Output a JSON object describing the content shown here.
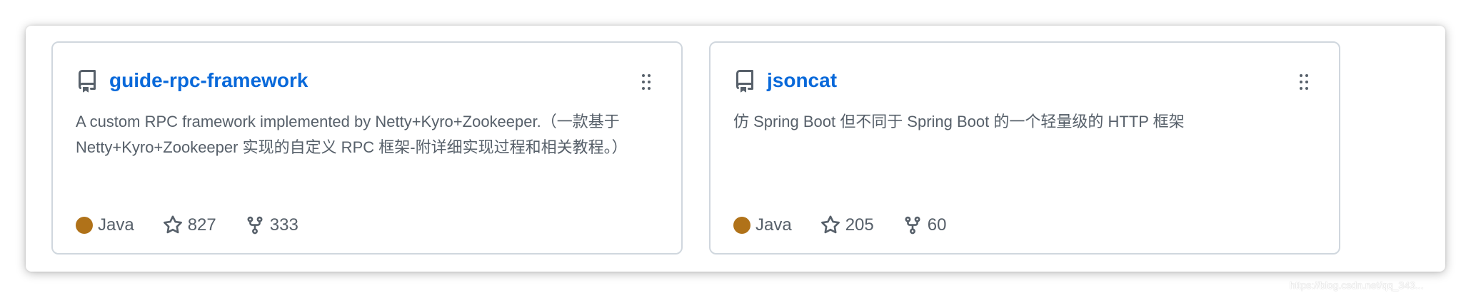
{
  "cards": [
    {
      "name": "guide-rpc-framework",
      "description": "A custom RPC framework implemented by Netty+Kyro+Zookeeper.（一款基于 Netty+Kyro+Zookeeper 实现的自定义 RPC 框架-附详细实现过程和相关教程。）",
      "language": "Java",
      "language_color": "#b07219",
      "stars": "827",
      "forks": "333"
    },
    {
      "name": "jsoncat",
      "description": "仿 Spring Boot 但不同于 Spring Boot 的一个轻量级的 HTTP 框架",
      "language": "Java",
      "language_color": "#b07219",
      "stars": "205",
      "forks": "60"
    }
  ],
  "icons": {
    "repo": "repo-icon",
    "drag": "grabber-icon",
    "star": "star-icon",
    "fork": "fork-icon"
  },
  "colors": {
    "link": "#0969da",
    "muted": "#57606a",
    "border": "#d0d7de"
  },
  "watermark": "https://blog.csdn.net/qq_343..."
}
